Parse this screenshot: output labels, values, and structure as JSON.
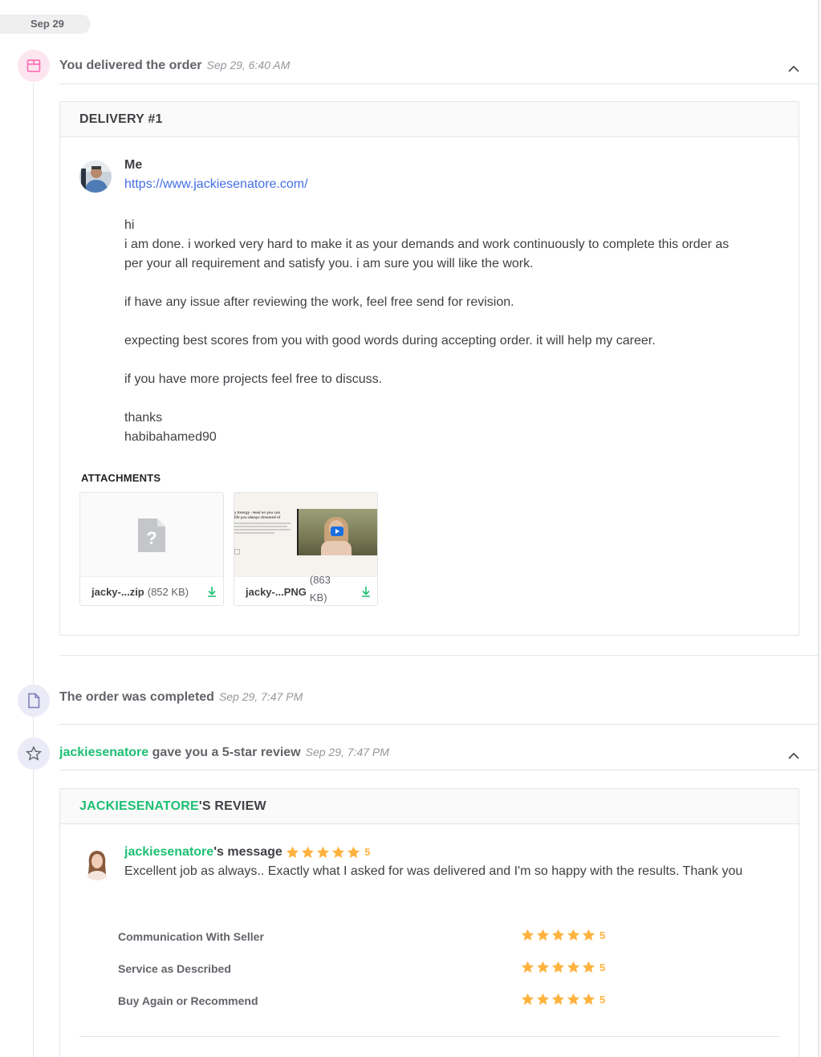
{
  "date_label": "Sep 29",
  "colors": {
    "accent_green": "#1dbf73",
    "link_blue": "#446ee7",
    "star_orange": "#ffb33e",
    "delivered_icon_bg": "#fde5ef",
    "event_icon_bg": "#ebeaf7"
  },
  "events": {
    "delivered": {
      "icon": "package-icon",
      "title": "You delivered the order",
      "time": "Sep 29, 6:40 AM"
    },
    "completed": {
      "icon": "document-icon",
      "title": "The order was completed",
      "time": "Sep 29, 7:47 PM"
    },
    "review": {
      "icon": "star-outline-icon",
      "user": "jackiesenatore",
      "title_suffix": "gave you a 5-star review",
      "time": "Sep 29, 7:47 PM"
    }
  },
  "delivery": {
    "header": "DELIVERY #1",
    "sender": "Me",
    "link": "https://www.jackiesenatore.com/",
    "message": [
      "hi",
      "i am done. i worked very hard to make it as your demands and work continuously to complete this order as per your all requirement and satisfy you. i am sure you will like the work.",
      "",
      "if have any issue after reviewing the work, feel free send for revision.",
      "",
      "expecting best scores from you with good words during accepting order. it will help my career.",
      "",
      "if you have more projects feel free to discuss.",
      "",
      "thanks",
      "habibahamed90"
    ],
    "attachments_label": "ATTACHMENTS",
    "attachments": [
      {
        "name": "jacky-...zip",
        "size": "(852 KB)",
        "type": "unknown-file-icon"
      },
      {
        "name": "jacky-...PNG",
        "size": "(863 KB)",
        "type": "image",
        "thumb_text": [
          "y Energy - Heal so you can",
          "life you always dreamed of"
        ]
      }
    ]
  },
  "review": {
    "header_user": "JACKIESENATORE",
    "header_suffix": "'S REVIEW",
    "reviewer": "jackiesenatore",
    "message_suffix": "'s message",
    "rating": 5,
    "rating_label": "5",
    "text": "Excellent job as always.. Exactly what I asked for was delivered and I'm so happy with the results. Thank you",
    "breakdown": [
      {
        "label": "Communication With Seller",
        "rating": 5,
        "value": "5"
      },
      {
        "label": "Service as Described",
        "rating": 5,
        "value": "5"
      },
      {
        "label": "Buy Again or Recommend",
        "rating": 5,
        "value": "5"
      }
    ]
  }
}
